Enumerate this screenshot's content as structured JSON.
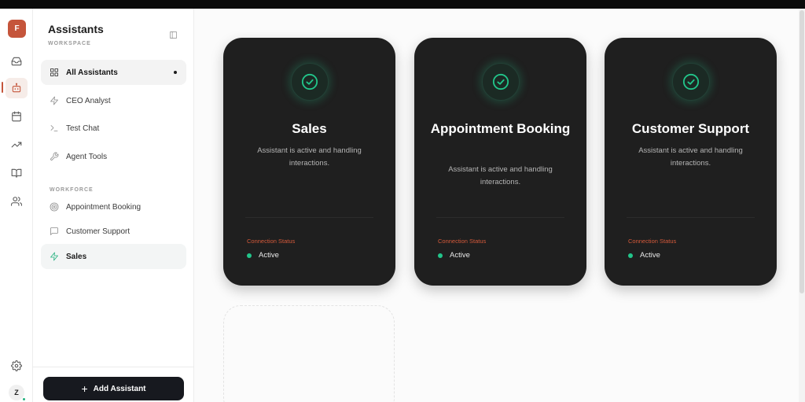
{
  "rail": {
    "avatar_letter": "F",
    "icons": [
      "inbox-icon",
      "bot-icon",
      "calendar-icon",
      "trending-icon",
      "book-icon",
      "users-icon"
    ],
    "settings_icon": "settings-icon",
    "user_initial": "Z",
    "accent_color": "#c5553b"
  },
  "sidebar": {
    "title": "Assistants",
    "subtitle": "WORKSPACE",
    "items": [
      {
        "label": "All Assistants",
        "icon": "grid-icon"
      },
      {
        "label": "CEO Analyst",
        "icon": "zap-icon"
      },
      {
        "label": "Test Chat",
        "icon": "terminal-icon"
      },
      {
        "label": "Agent Tools",
        "icon": "wrench-icon"
      }
    ],
    "section_label": "WORKFORCE",
    "workforce": [
      {
        "label": "Appointment Booking",
        "icon": "target-icon"
      },
      {
        "label": "Customer Support",
        "icon": "message-icon"
      },
      {
        "label": "Sales",
        "icon": "zap-icon"
      }
    ],
    "add_button": "Add Assistant"
  },
  "cards": [
    {
      "title": "Sales",
      "description": "Assistant is active and handling interactions.",
      "status_label": "Connection Status",
      "status": "Active"
    },
    {
      "title": "Appointment Booking",
      "description": "Assistant is active and handling interactions.",
      "status_label": "Connection Status",
      "status": "Active"
    },
    {
      "title": "Customer Support",
      "description": "Assistant is active and handling interactions.",
      "status_label": "Connection Status",
      "status": "Active"
    }
  ],
  "colors": {
    "card_bg": "#1f1f1f",
    "status_active": "#22c58a",
    "status_label": "#d4593a",
    "button_bg": "#17191f"
  }
}
